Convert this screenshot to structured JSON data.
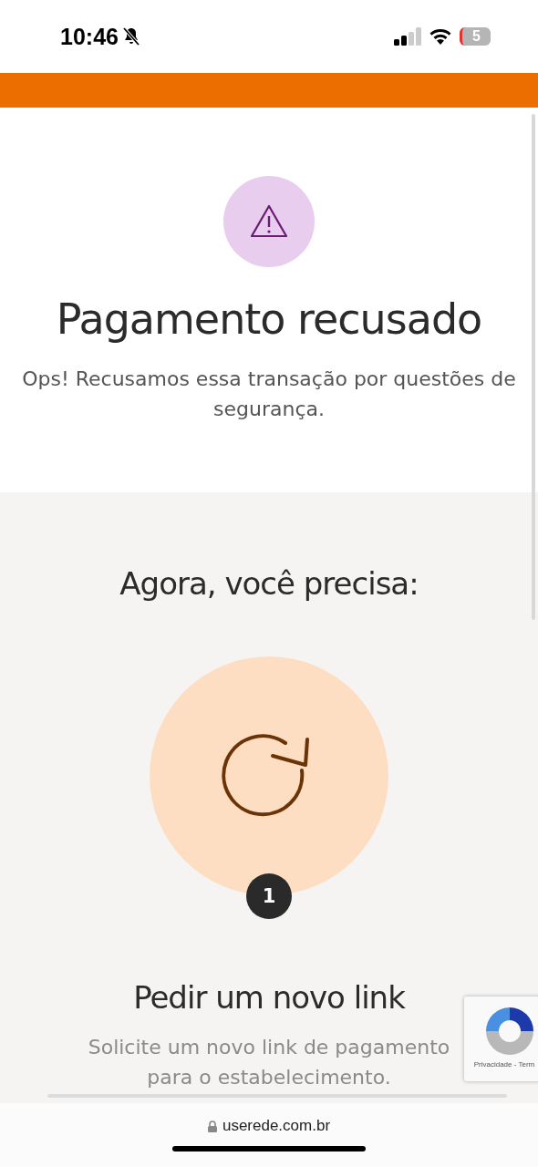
{
  "status_bar": {
    "time": "10:46",
    "battery": "5"
  },
  "result": {
    "title": "Pagamento recusado",
    "message": "Ops! Recusamos essa transação por questões de segurança."
  },
  "next_steps": {
    "heading": "Agora, você precisa:",
    "steps": [
      {
        "number": "1",
        "title": "Pedir um novo link",
        "description": "Solicite um novo link de pagamento para o estabelecimento."
      }
    ]
  },
  "recaptcha": {
    "links": "Privacidade - Term"
  },
  "browser": {
    "url": "userede.com.br"
  }
}
